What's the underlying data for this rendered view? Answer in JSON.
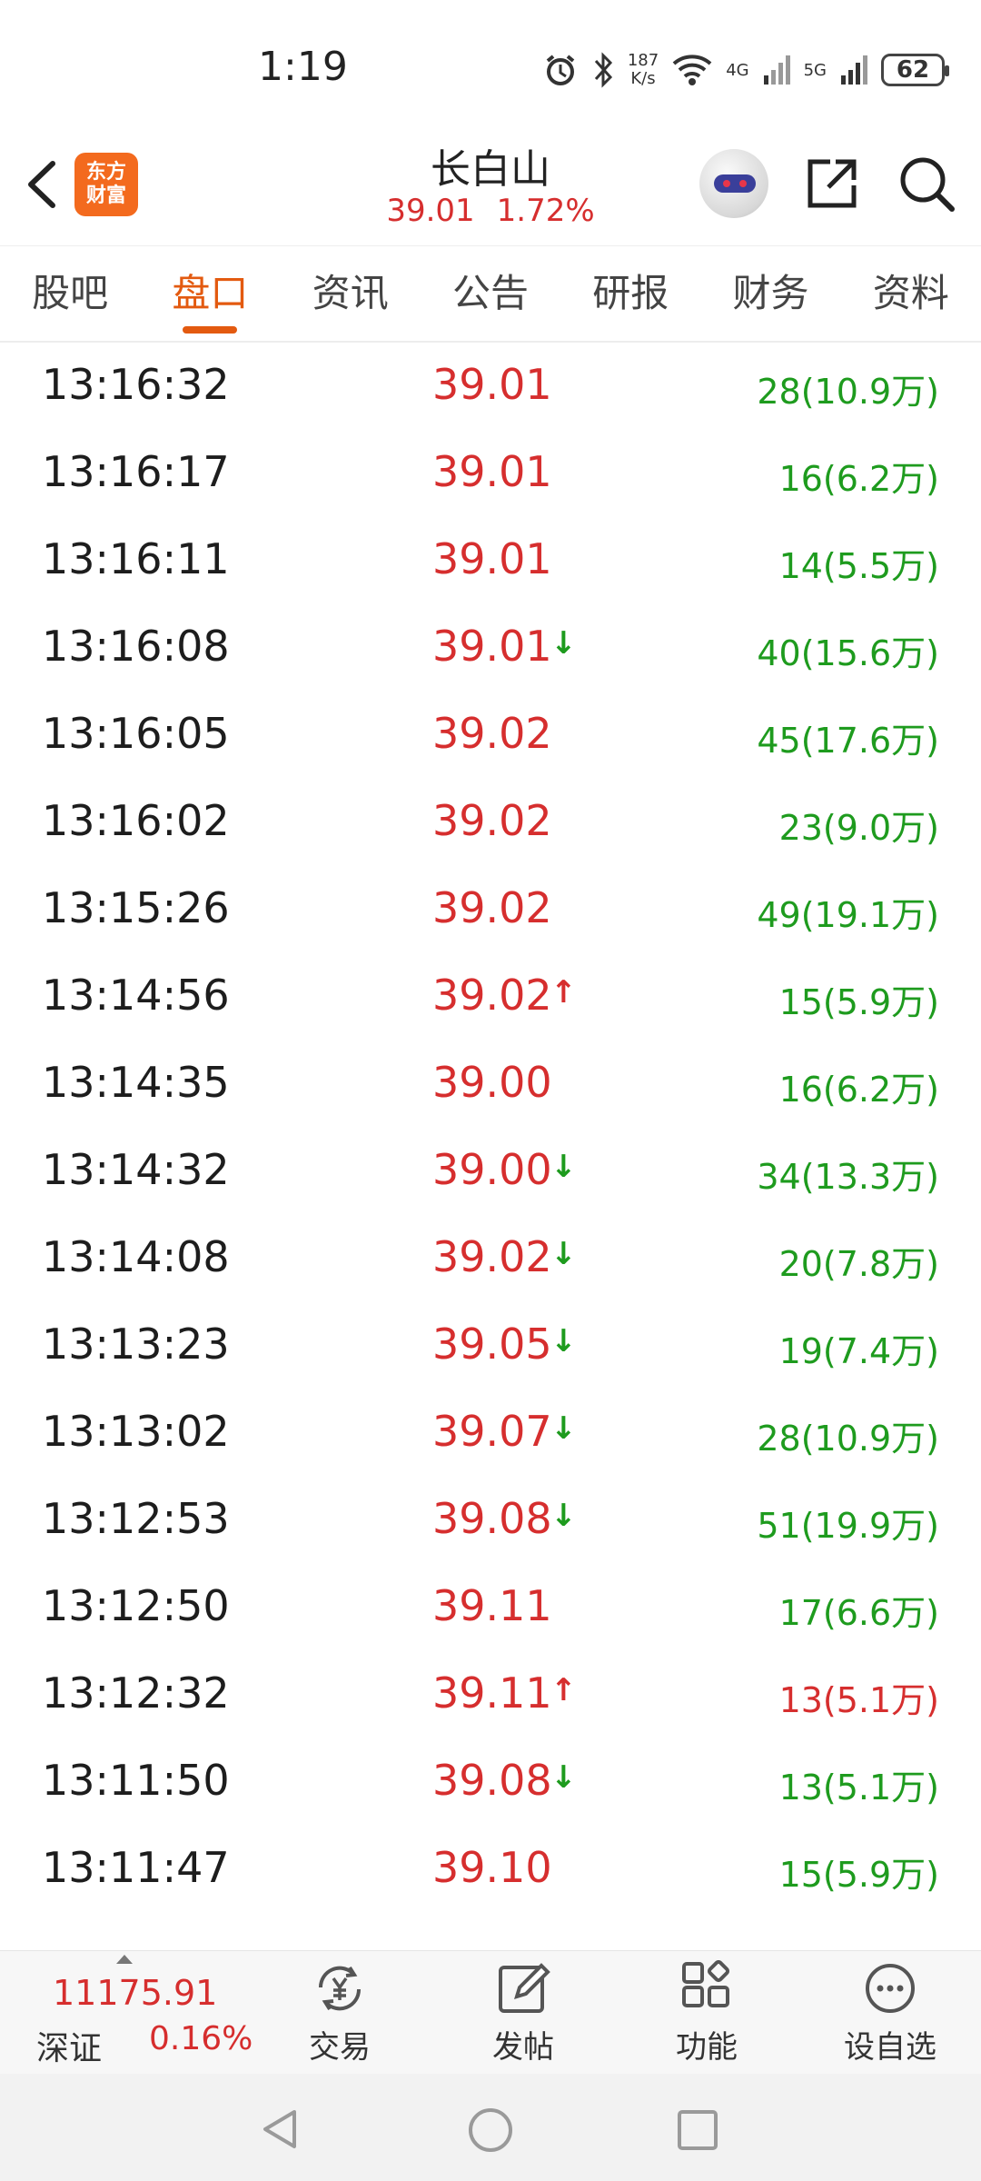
{
  "status_bar": {
    "time": "1:19",
    "net_speed_value": "187",
    "net_speed_unit": "K/s",
    "net_4g": "4G",
    "net_5g": "5G",
    "battery": "62"
  },
  "header": {
    "logo_line1": "东方",
    "logo_line2": "财富",
    "title": "长白山",
    "price": "39.01",
    "change_pct": "1.72%"
  },
  "tabs": [
    "股吧",
    "盘口",
    "资讯",
    "公告",
    "研报",
    "财务",
    "资料"
  ],
  "active_tab": "盘口",
  "ticks": [
    {
      "time": "13:16:32",
      "price": "39.01",
      "arrow": "",
      "volume": "28(10.9万)",
      "vol_color": "green"
    },
    {
      "time": "13:16:17",
      "price": "39.01",
      "arrow": "",
      "volume": "16(6.2万)",
      "vol_color": "green"
    },
    {
      "time": "13:16:11",
      "price": "39.01",
      "arrow": "",
      "volume": "14(5.5万)",
      "vol_color": "green"
    },
    {
      "time": "13:16:08",
      "price": "39.01",
      "arrow": "↓",
      "volume": "40(15.6万)",
      "vol_color": "green"
    },
    {
      "time": "13:16:05",
      "price": "39.02",
      "arrow": "",
      "volume": "45(17.6万)",
      "vol_color": "green"
    },
    {
      "time": "13:16:02",
      "price": "39.02",
      "arrow": "",
      "volume": "23(9.0万)",
      "vol_color": "green"
    },
    {
      "time": "13:15:26",
      "price": "39.02",
      "arrow": "",
      "volume": "49(19.1万)",
      "vol_color": "green"
    },
    {
      "time": "13:14:56",
      "price": "39.02",
      "arrow": "↑",
      "volume": "15(5.9万)",
      "vol_color": "green"
    },
    {
      "time": "13:14:35",
      "price": "39.00",
      "arrow": "",
      "volume": "16(6.2万)",
      "vol_color": "green"
    },
    {
      "time": "13:14:32",
      "price": "39.00",
      "arrow": "↓",
      "volume": "34(13.3万)",
      "vol_color": "green"
    },
    {
      "time": "13:14:08",
      "price": "39.02",
      "arrow": "↓",
      "volume": "20(7.8万)",
      "vol_color": "green"
    },
    {
      "time": "13:13:23",
      "price": "39.05",
      "arrow": "↓",
      "volume": "19(7.4万)",
      "vol_color": "green"
    },
    {
      "time": "13:13:02",
      "price": "39.07",
      "arrow": "↓",
      "volume": "28(10.9万)",
      "vol_color": "green"
    },
    {
      "time": "13:12:53",
      "price": "39.08",
      "arrow": "↓",
      "volume": "51(19.9万)",
      "vol_color": "green"
    },
    {
      "time": "13:12:50",
      "price": "39.11",
      "arrow": "",
      "volume": "17(6.6万)",
      "vol_color": "green"
    },
    {
      "time": "13:12:32",
      "price": "39.11",
      "arrow": "↑",
      "volume": "13(5.1万)",
      "vol_color": "red"
    },
    {
      "time": "13:11:50",
      "price": "39.08",
      "arrow": "↓",
      "volume": "13(5.1万)",
      "vol_color": "green"
    },
    {
      "time": "13:11:47",
      "price": "39.10",
      "arrow": "",
      "volume": "15(5.9万)",
      "vol_color": "green"
    }
  ],
  "index": {
    "value": "11175.91",
    "name": "深证",
    "change": "0.16%"
  },
  "toolbar": {
    "trade": "交易",
    "post": "发帖",
    "functions": "功能",
    "set_watch": "设自选"
  },
  "colors": {
    "accent": "#e35a10",
    "up": "#d62e2e",
    "down": "#1e9b1e"
  }
}
